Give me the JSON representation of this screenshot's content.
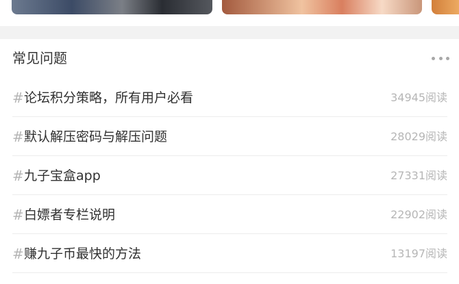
{
  "faq": {
    "title": "常见问题",
    "more_icon": "more-horizontal-icon",
    "hash_symbol": "#",
    "items": [
      {
        "label": "论坛积分策略，所有用户必看",
        "reads": "34945阅读"
      },
      {
        "label": "默认解压密码与解压问题",
        "reads": "28029阅读"
      },
      {
        "label": "九子宝盒app",
        "reads": "27331阅读"
      },
      {
        "label": "白嫖者专栏说明",
        "reads": "22902阅读"
      },
      {
        "label": "赚九子币最快的方法",
        "reads": "13197阅读"
      }
    ]
  }
}
